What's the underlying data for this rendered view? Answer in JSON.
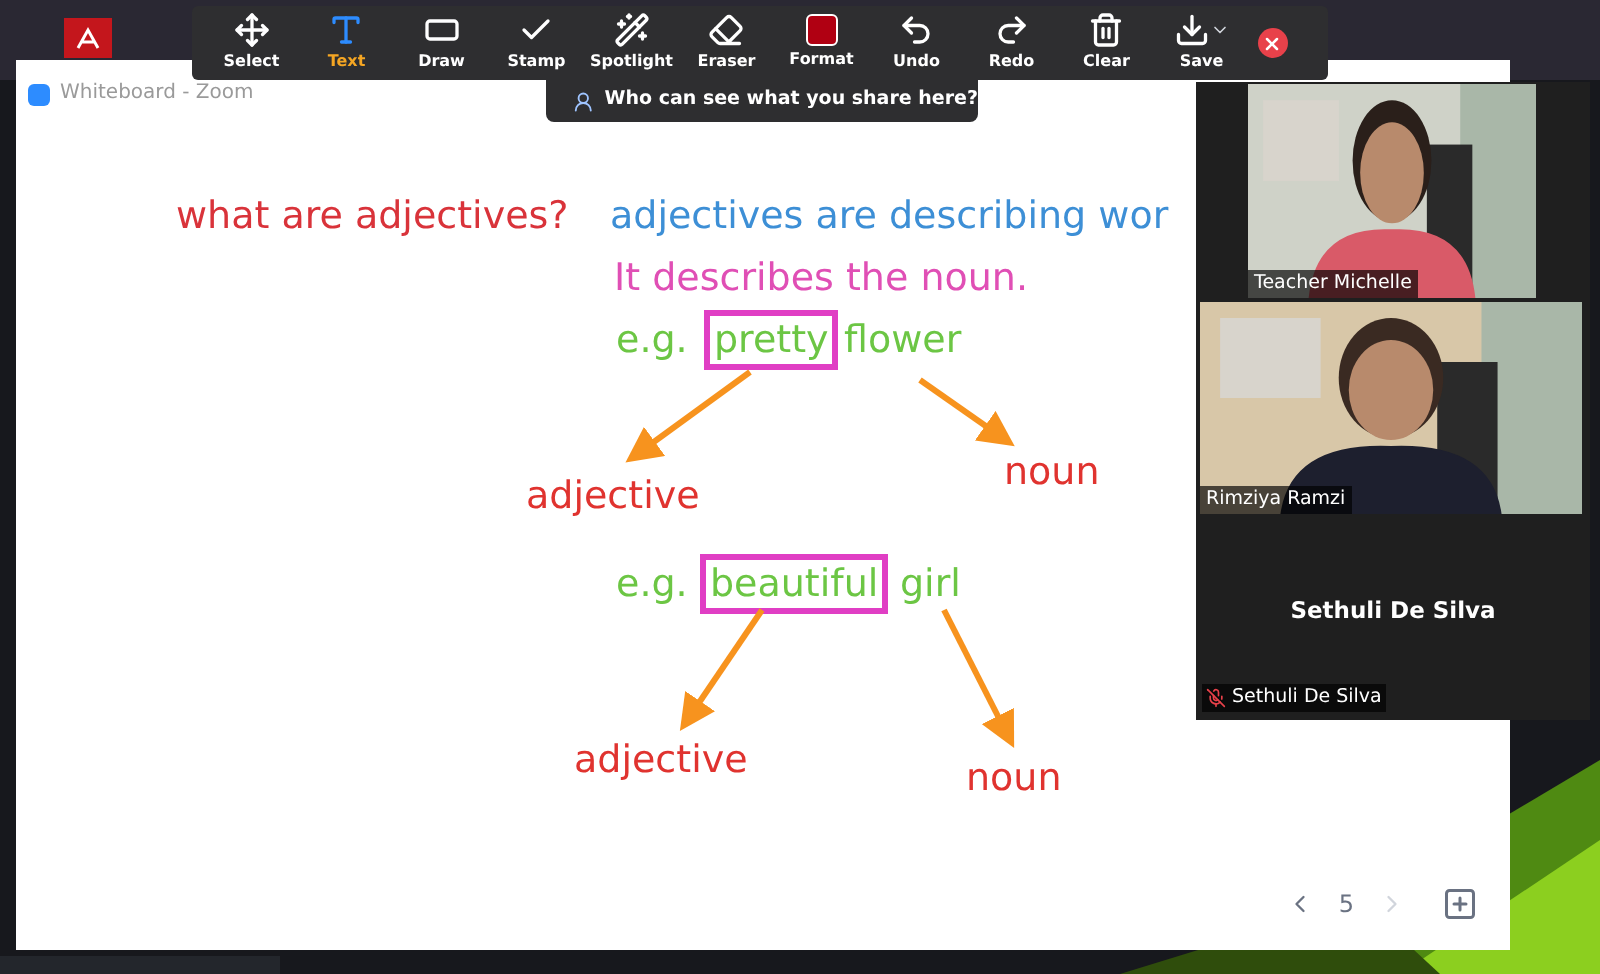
{
  "window": {
    "title": "Whiteboard - Zoom"
  },
  "toolbar": {
    "tools": [
      {
        "label": "Select",
        "selected": false
      },
      {
        "label": "Text",
        "selected": true
      },
      {
        "label": "Draw",
        "selected": false
      },
      {
        "label": "Stamp",
        "selected": false
      },
      {
        "label": "Spotlight",
        "selected": false
      },
      {
        "label": "Eraser",
        "selected": false
      },
      {
        "label": "Format",
        "selected": false
      },
      {
        "label": "Undo",
        "selected": false
      },
      {
        "label": "Redo",
        "selected": false
      },
      {
        "label": "Clear",
        "selected": false
      },
      {
        "label": "Save",
        "selected": false
      }
    ]
  },
  "share_notice": "Who can see what you share here?",
  "whiteboard": {
    "texts": [
      {
        "text": "what are adjectives?",
        "color": "#d9333a",
        "boxed": false
      },
      {
        "text": "adjectives are describing wor",
        "color": "#3d8fd6",
        "boxed": false
      },
      {
        "text": "It describes the noun.",
        "color": "#e04fb5",
        "boxed": false
      },
      {
        "text": "e.g.",
        "color": "#6cc644",
        "boxed": false
      },
      {
        "text": "pretty",
        "color": "#6cc644",
        "boxed": true
      },
      {
        "text": "flower",
        "color": "#6cc644",
        "boxed": false
      },
      {
        "text": "adjective",
        "color": "#e0332f",
        "boxed": false
      },
      {
        "text": "noun",
        "color": "#e0332f",
        "boxed": false
      },
      {
        "text": "e.g.",
        "color": "#6cc644",
        "boxed": false
      },
      {
        "text": "beautiful",
        "color": "#6cc644",
        "boxed": true
      },
      {
        "text": "girl",
        "color": "#6cc644",
        "boxed": false
      },
      {
        "text": "adjective",
        "color": "#e0332f",
        "boxed": false
      },
      {
        "text": "noun",
        "color": "#e0332f",
        "boxed": false
      }
    ],
    "page": "5",
    "next_disabled": true
  },
  "participants": [
    {
      "name": "Teacher Michelle",
      "kind": "video",
      "muted": false
    },
    {
      "name": "Rimziya Ramzi",
      "kind": "video",
      "muted": false
    },
    {
      "name": "Sethuli De Silva",
      "label": "Sethuli De Silva",
      "kind": "no_video",
      "muted": true
    }
  ]
}
